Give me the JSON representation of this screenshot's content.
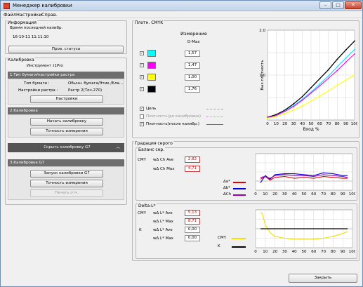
{
  "window": {
    "title": "Менеджер калибровки",
    "min_glyph": "–",
    "max_glyph": "□",
    "close_glyph": "✕"
  },
  "menu": [
    "Файл",
    "Настройки",
    "Справ."
  ],
  "info": {
    "title": "Информация",
    "last_calib_label": "Время последней калибр.",
    "last_calib_value": "16-10-11 11:11:10",
    "status_button": "Пров. статуса"
  },
  "calibration": {
    "title": "Калибровка",
    "instrument_label": "Инструмент :",
    "instrument_value": "i1Pro",
    "step1": {
      "header": "1.Тип бумаги/настройки растра",
      "paper_label": "Тип бумаги :",
      "paper_value": "Обычн. бумага/Этик./Бла...",
      "raster_label": "Настройки растра :",
      "raster_value": "Растр 2(Точ.270)",
      "settings_button": "Настройки"
    },
    "step2": {
      "header": "2.Калибровка",
      "start_button": "Начать калибровку",
      "accuracy_button": "Точность измерения"
    },
    "g7_toggle": "Скрыть калибровку G7",
    "g7_toggle_glyph": "︿",
    "step3": {
      "header": "3.Калибровка G7",
      "g7_start_button": "Запуск калибровки G7",
      "accuracy_button": "Точность измерения",
      "print_button": "Печать отч."
    }
  },
  "density": {
    "title": "Плотн. CMYK",
    "measure_header": "Измерение",
    "dmax_header": "D-Max",
    "channels": [
      {
        "name": "C",
        "color": "#00ffff",
        "value": "1,57",
        "checked": true
      },
      {
        "name": "M",
        "color": "#ff00ff",
        "value": "1,47",
        "checked": true
      },
      {
        "name": "Y",
        "color": "#ffff00",
        "value": "1,00",
        "checked": true
      },
      {
        "name": "K",
        "color": "#000000",
        "value": "1,76",
        "checked": true
      }
    ],
    "legend": [
      {
        "label": "Цель",
        "checked": true,
        "style": "dashed",
        "color": "#ff66ff"
      },
      {
        "label": "Плотность(до калибровки)",
        "checked": false,
        "style": "dotted",
        "color": "#ff66ff"
      },
      {
        "label": "Плотность(после калибр.)",
        "checked": true,
        "style": "solid",
        "color": "#ff00ff"
      }
    ],
    "check_glyph": "✓"
  },
  "gray": {
    "title": "Градация серого",
    "balance_title": "Баланс сер.",
    "cmy_label": "CMY",
    "ch_ave_label": "wΔ Ch Ave",
    "ch_ave_value": "2,82",
    "ch_max_label": "wΔ Ch Max",
    "ch_max_value": "4,71",
    "balance_legend": [
      {
        "label": "Δa*",
        "color": "#e00000"
      },
      {
        "label": "Δb*",
        "color": "#0000e0"
      },
      {
        "label": "ΔCh",
        "color": "#9900aa"
      }
    ],
    "deltal_title": "Delta-L*",
    "l_cmy_label": "CMY",
    "l_ave_label": "wΔ L* Ave",
    "l_cmy_ave": "5,13",
    "l_max_label": "wΔ L* Max",
    "l_cmy_max": "8,71",
    "l_k_label": "K",
    "l_k_ave_label": "wΔ L* Ave",
    "l_k_ave": "0,00",
    "l_k_max_label": "wΔ L* Max",
    "l_k_max": "0,00",
    "deltal_legend": [
      {
        "label": "CMY",
        "color": "#f0e000"
      },
      {
        "label": "K",
        "color": "#000000"
      }
    ]
  },
  "close_button": "Закрыть",
  "chart_data": [
    {
      "type": "line",
      "title": "",
      "xlabel": "Вход %",
      "ylabel": "Вых.плотность",
      "xlim": [
        0,
        100
      ],
      "ylim": [
        0,
        2.0
      ],
      "x_ticks": [
        "0",
        "10",
        "20",
        "30",
        "40",
        "50",
        "60",
        "70",
        "80",
        "90",
        "100"
      ],
      "y_ticks": [
        "1.0",
        "2.0"
      ],
      "grid": true,
      "series": [
        {
          "name": "K",
          "color": "#000000",
          "x": [
            0,
            10,
            20,
            30,
            40,
            50,
            60,
            70,
            80,
            90,
            100
          ],
          "y": [
            0.06,
            0.12,
            0.22,
            0.36,
            0.52,
            0.72,
            0.92,
            1.12,
            1.35,
            1.56,
            1.76
          ]
        },
        {
          "name": "C",
          "color": "#00e0ff",
          "x": [
            0,
            10,
            20,
            30,
            40,
            50,
            60,
            70,
            80,
            90,
            100
          ],
          "y": [
            0.05,
            0.1,
            0.2,
            0.32,
            0.46,
            0.62,
            0.8,
            0.98,
            1.18,
            1.38,
            1.57
          ]
        },
        {
          "name": "M",
          "color": "#ff00ff",
          "x": [
            0,
            10,
            20,
            30,
            40,
            50,
            60,
            70,
            80,
            90,
            100
          ],
          "y": [
            0.05,
            0.1,
            0.19,
            0.3,
            0.44,
            0.6,
            0.76,
            0.93,
            1.1,
            1.29,
            1.47
          ]
        },
        {
          "name": "Y",
          "color": "#ffff00",
          "x": [
            0,
            10,
            20,
            30,
            40,
            50,
            60,
            70,
            80,
            90,
            100
          ],
          "y": [
            0.04,
            0.08,
            0.14,
            0.22,
            0.31,
            0.42,
            0.53,
            0.65,
            0.77,
            0.89,
            1.0
          ]
        }
      ]
    },
    {
      "type": "line",
      "title": "",
      "xlim": [
        0,
        100
      ],
      "ylim": [
        -5,
        15
      ],
      "x_ticks": [
        "0",
        "10",
        "20",
        "30",
        "40",
        "50",
        "60",
        "70",
        "80",
        "90",
        "100"
      ],
      "grid": true,
      "series": [
        {
          "name": "Δa*",
          "color": "#e00000",
          "x": [
            5,
            10,
            15,
            20,
            30,
            40,
            50,
            60,
            70,
            80,
            90,
            95
          ],
          "y": [
            1,
            2.5,
            0.5,
            2,
            2.5,
            1.5,
            2,
            1.5,
            2.5,
            2,
            1.5,
            1.5
          ]
        },
        {
          "name": "Δb*",
          "color": "#0000e0",
          "x": [
            5,
            10,
            15,
            20,
            30,
            40,
            50,
            60,
            70,
            80,
            90,
            95
          ],
          "y": [
            -1,
            3,
            1,
            3.5,
            4,
            4,
            3.5,
            3,
            4.5,
            4,
            3,
            3
          ]
        },
        {
          "name": "ΔCh",
          "color": "#9900aa",
          "x": [
            5,
            10,
            15,
            20,
            30,
            40,
            50,
            60,
            70,
            80,
            90,
            95
          ],
          "y": [
            2,
            2.5,
            1.5,
            3,
            3.5,
            3,
            3,
            2.5,
            3.5,
            3,
            2.5,
            2
          ]
        }
      ]
    },
    {
      "type": "line",
      "title": "",
      "xlim": [
        0,
        100
      ],
      "ylim": [
        -10,
        10
      ],
      "x_ticks": [
        "0",
        "10",
        "20",
        "30",
        "40",
        "50",
        "60",
        "70",
        "80",
        "90",
        "100"
      ],
      "grid": true,
      "series": [
        {
          "name": "CMY",
          "color": "#f0e000",
          "x": [
            5,
            7,
            10,
            15,
            20,
            30,
            40,
            50,
            60,
            70,
            80,
            90,
            95
          ],
          "y": [
            8.7,
            8,
            2,
            -2,
            -4,
            -5,
            -5.5,
            -5.5,
            -5.5,
            -5,
            -4,
            -2.5,
            -1.5
          ]
        },
        {
          "name": "K",
          "color": "#000000",
          "x": [
            5,
            95
          ],
          "y": [
            0,
            0
          ]
        }
      ]
    }
  ]
}
